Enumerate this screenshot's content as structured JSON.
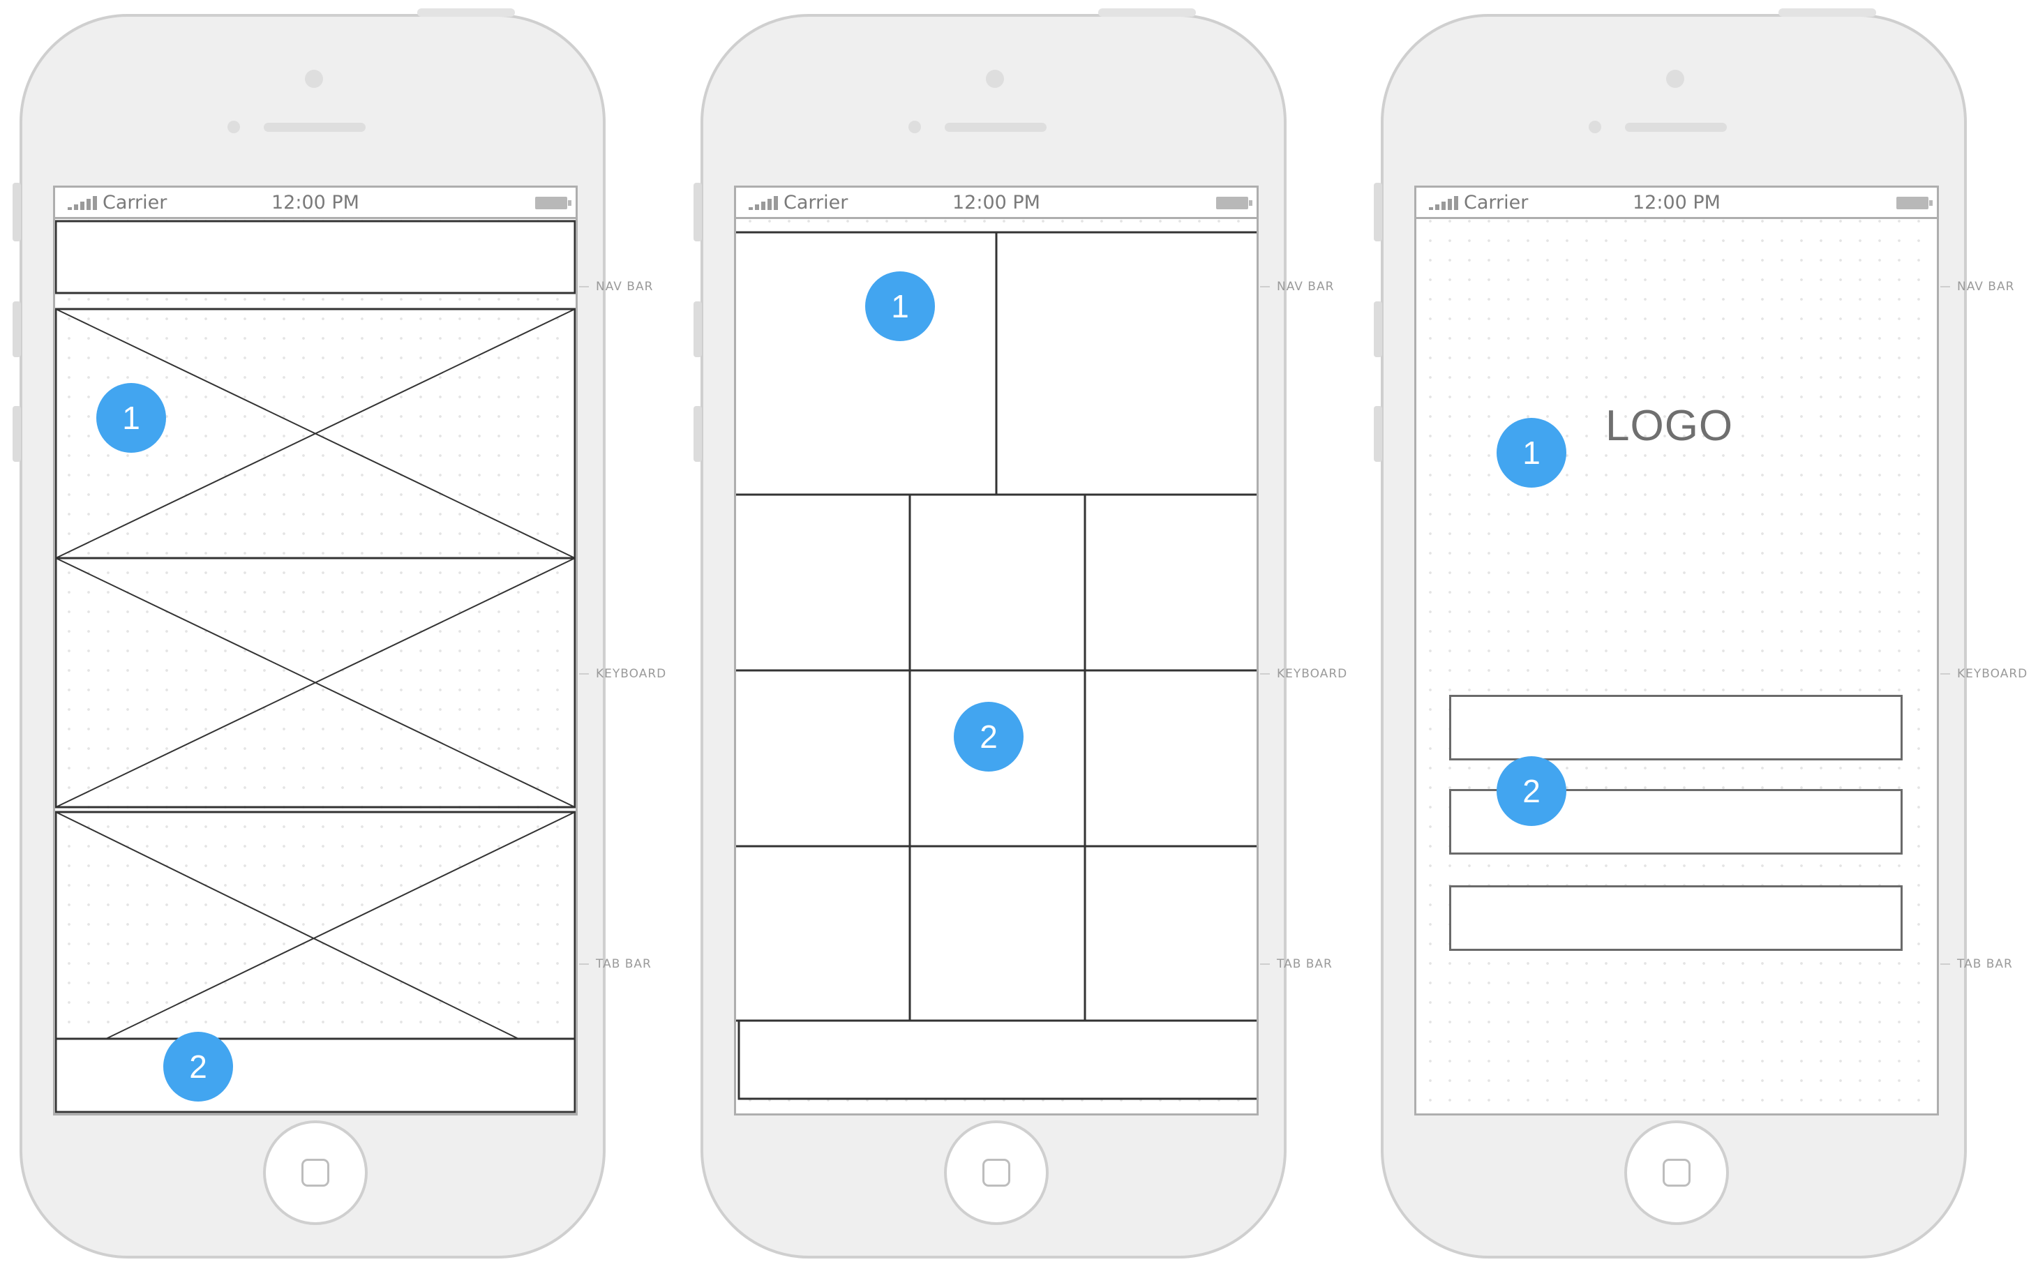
{
  "status_bar": {
    "carrier": "Carrier",
    "time": "12:00 PM"
  },
  "markers": {
    "nav_bar": "NAV BAR",
    "keyboard": "KEYBOARD",
    "tab_bar": "TAB BAR"
  },
  "phones": [
    {
      "badges": [
        "1",
        "2"
      ]
    },
    {
      "badges": [
        "1",
        "2"
      ]
    },
    {
      "badges": [
        "1",
        "2"
      ],
      "logo": "LOGO"
    }
  ],
  "colors": {
    "badge": "#42a5f0",
    "phone_body": "#efefef",
    "outline": "#cfcfcf",
    "wire": "#333333"
  }
}
